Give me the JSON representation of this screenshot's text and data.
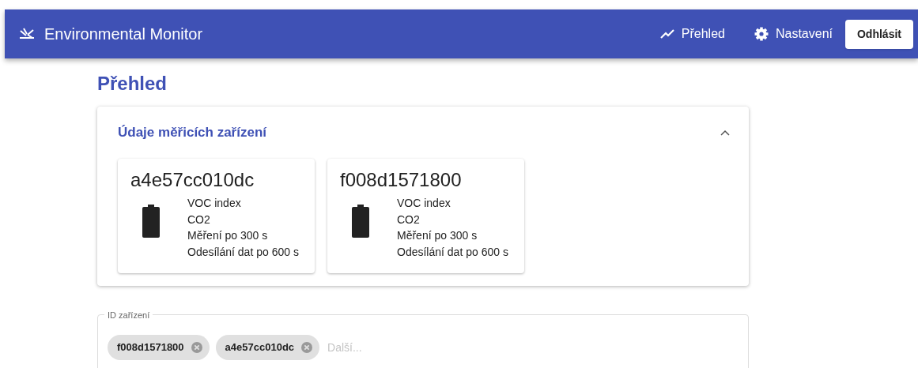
{
  "app_bar": {
    "title": "Environmental Monitor",
    "nav": [
      {
        "kind": "chart",
        "label": "Přehled"
      },
      {
        "kind": "settings",
        "label": "Nastavení"
      }
    ],
    "logout_button": "Odhlásit"
  },
  "page_title": "Přehled",
  "panel": {
    "title": "Údaje měřicích zařízení",
    "expanded": true,
    "devices": [
      {
        "id": "a4e57cc010dc",
        "lines": [
          "VOC index",
          "CO2",
          "Měření po 300 s",
          "Odesílání dat po 600 s"
        ]
      },
      {
        "id": "f008d1571800",
        "lines": [
          "VOC index",
          "CO2",
          "Měření po 300 s",
          "Odesílání dat po 600 s"
        ]
      }
    ]
  },
  "device_field": {
    "label": "ID zařízení",
    "chips": [
      "f008d1571800",
      "a4e57cc010dc"
    ],
    "placeholder": "Další..."
  }
}
